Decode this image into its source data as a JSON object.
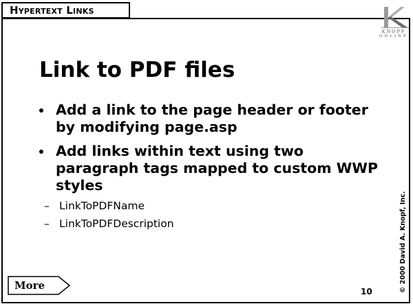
{
  "header": {
    "section_label": "Hypertext Links"
  },
  "logo": {
    "icon": "knopf-k-logo",
    "line1": "KNOPF",
    "line2": "ONLINE"
  },
  "slide": {
    "title": "Link to PDF files",
    "bullets": [
      {
        "text": "Add a link to the page header or footer by modifying page.asp"
      },
      {
        "text": "Add links within text using two paragraph tags mapped to custom WWP styles",
        "subitems": [
          "LinkToPDFName",
          "LinkToPDFDescription"
        ]
      }
    ]
  },
  "footer": {
    "more_label": "More",
    "page_number": "10",
    "copyright": "© 2000 David A. Knopf, Inc."
  }
}
